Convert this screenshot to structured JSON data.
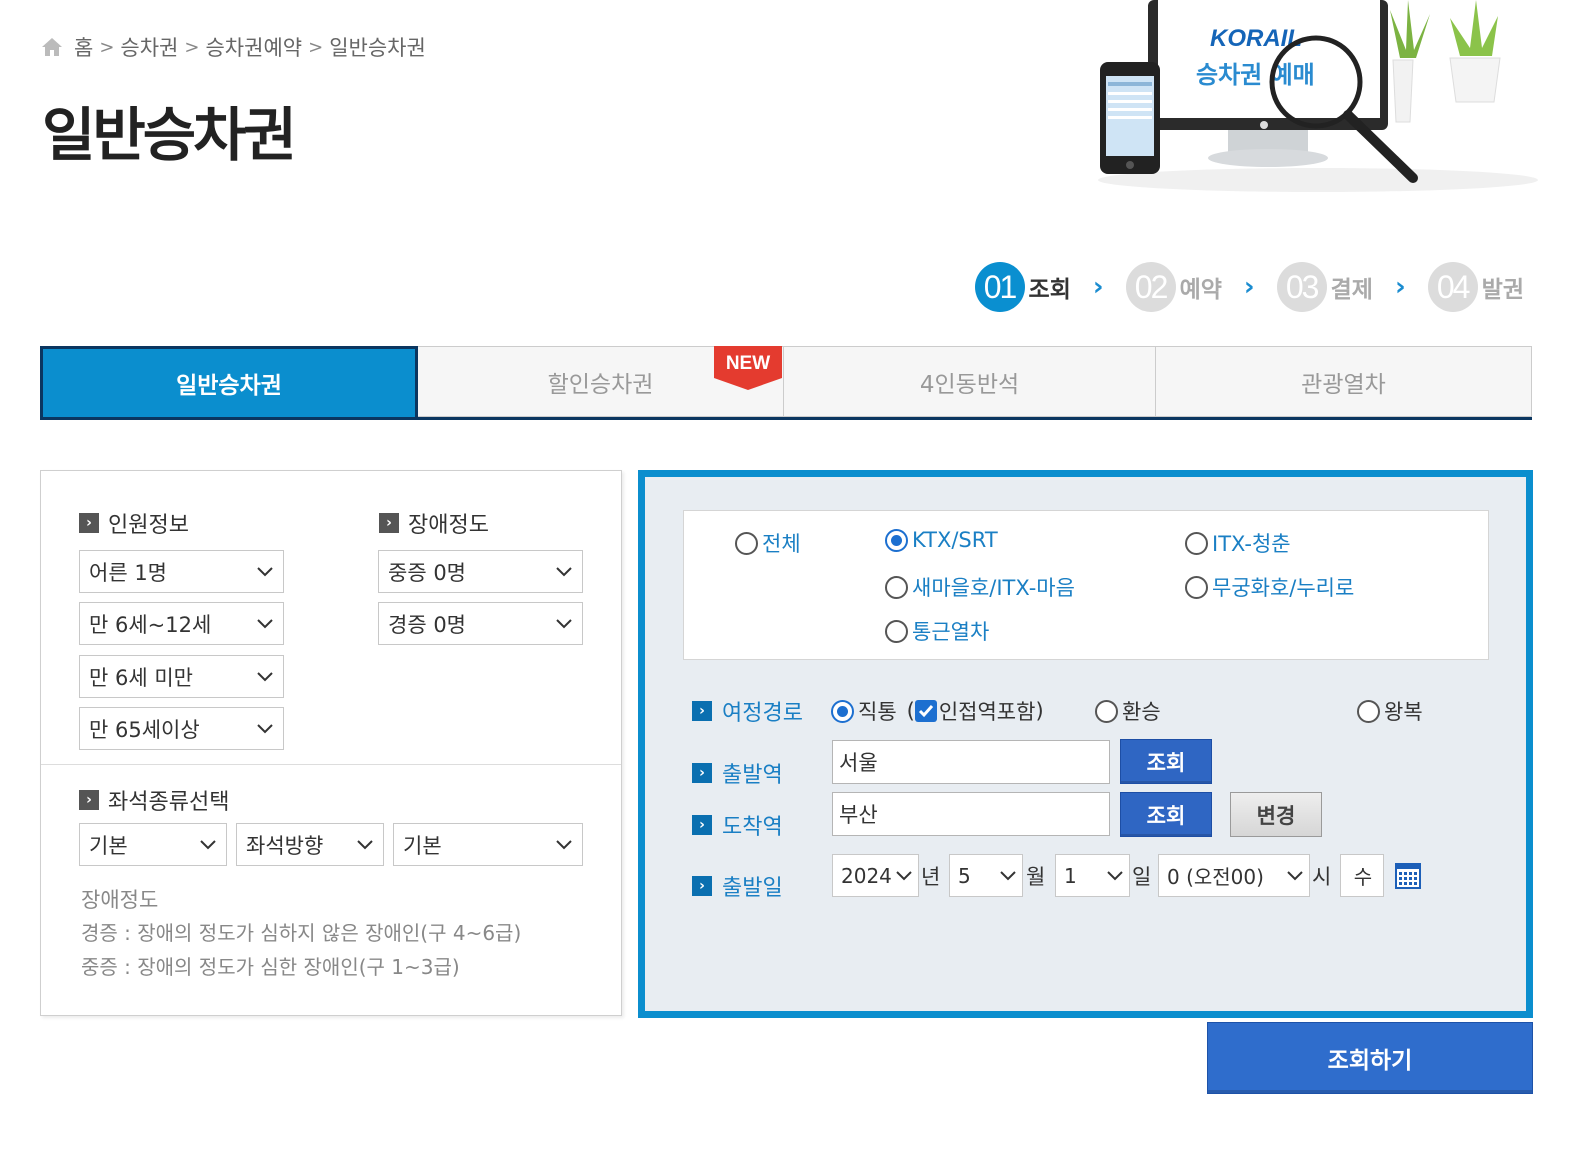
{
  "breadcrumb": [
    "홈",
    "승차권",
    "승차권예약",
    "일반승차권"
  ],
  "page_title": "일반승차권",
  "hero": {
    "brand": "KORAIL",
    "caption": "승차권 예매"
  },
  "steps": [
    {
      "num": "01",
      "label": "조회",
      "active": true
    },
    {
      "num": "02",
      "label": "예약",
      "active": false
    },
    {
      "num": "03",
      "label": "결제",
      "active": false
    },
    {
      "num": "04",
      "label": "발권",
      "active": false
    }
  ],
  "tabs": [
    {
      "label": "일반승차권",
      "active": true
    },
    {
      "label": "할인승차권",
      "badge": "NEW"
    },
    {
      "label": "4인동반석"
    },
    {
      "label": "관광열차"
    }
  ],
  "passengers": {
    "title": "인원정보",
    "selects": [
      "어른 1명",
      "만 6세~12세",
      "만 6세 미만",
      "만 65세이상"
    ]
  },
  "disability": {
    "title": "장애정도",
    "selects": [
      "중증 0명",
      "경증 0명"
    ]
  },
  "seat": {
    "title": "좌석종류선택",
    "selects": [
      "기본",
      "좌석방향",
      "기본"
    ]
  },
  "note": {
    "title": "장애정도",
    "lines": [
      "경증 : 장애의 정도가 심하지 않은 장애인(구 4~6급)",
      "중증 : 장애의 정도가 심한 장애인(구 1~3급)"
    ]
  },
  "train_types": [
    {
      "label": "전체",
      "checked": false
    },
    {
      "label": "KTX/SRT",
      "checked": true
    },
    {
      "label": "ITX-청춘",
      "checked": false
    },
    {
      "label": "새마을호/ITX-마음",
      "checked": false
    },
    {
      "label": "무궁화호/누리로",
      "checked": false
    },
    {
      "label": "통근열차",
      "checked": false
    }
  ],
  "route": {
    "label": "여정경로",
    "direct": "직통",
    "open_paren": "(",
    "nearby": "인접역포함",
    "close_paren": ")",
    "transfer": "환승",
    "round_trip": "왕복"
  },
  "departure": {
    "label": "출발역",
    "value": "서울",
    "button": "조회"
  },
  "arrival": {
    "label": "도착역",
    "value": "부산",
    "button": "조회",
    "swap": "변경"
  },
  "date": {
    "label": "출발일",
    "year": "2024",
    "year_unit": "년",
    "month": "5",
    "month_unit": "월",
    "day": "1",
    "day_unit": "일",
    "hour": "0 (오전00)",
    "hour_unit": "시",
    "weekday": "수"
  },
  "search_button": "조회하기",
  "colors": {
    "accent": "#0b8ece",
    "navy": "#0b3660",
    "button": "#2f66c3",
    "link": "#1a7fc4"
  }
}
